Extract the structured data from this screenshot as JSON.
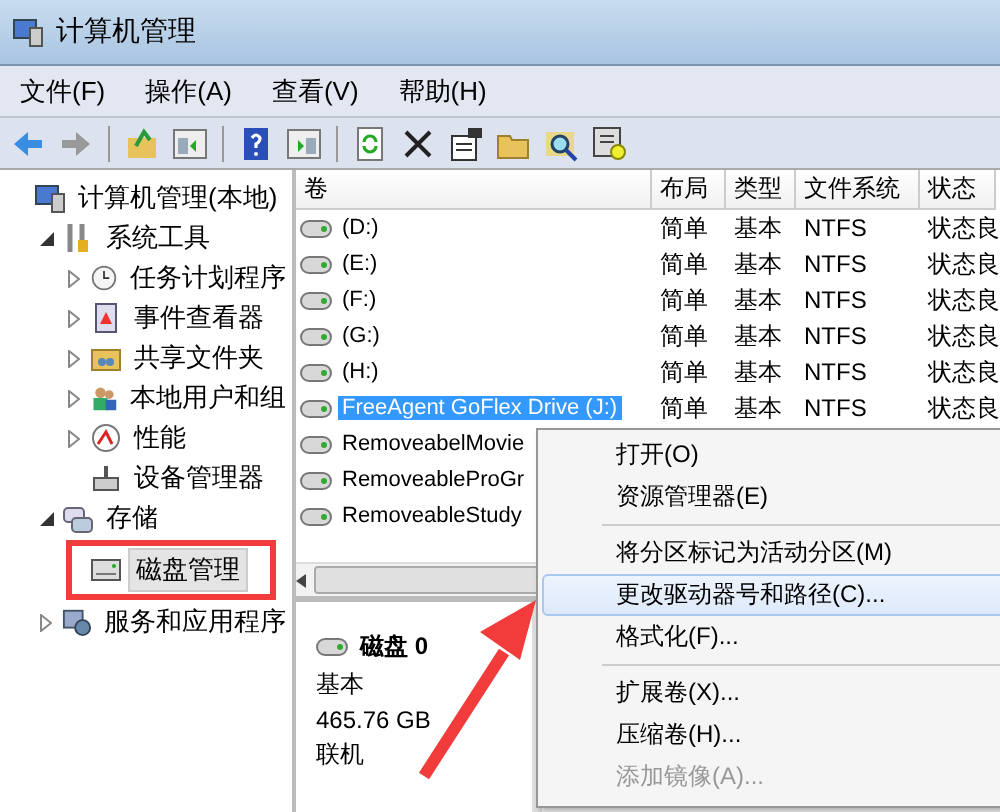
{
  "window": {
    "title": "计算机管理"
  },
  "menu_bar": [
    "文件(F)",
    "操作(A)",
    "查看(V)",
    "帮助(H)"
  ],
  "tree": {
    "label": "计算机管理(本地)",
    "selected": false,
    "children": [
      {
        "label": "系统工具",
        "expanded": true,
        "selected": false,
        "children": [
          {
            "label": "任务计划程序",
            "expanded": false,
            "selected": false
          },
          {
            "label": "事件查看器",
            "expanded": false,
            "selected": false
          },
          {
            "label": "共享文件夹",
            "expanded": false,
            "selected": false
          },
          {
            "label": "本地用户和组",
            "expanded": false,
            "selected": false
          },
          {
            "label": "性能",
            "expanded": false,
            "selected": false
          },
          {
            "label": "设备管理器",
            "selected": false
          }
        ]
      },
      {
        "label": "存储",
        "expanded": true,
        "selected": false,
        "children": [
          {
            "label": "磁盘管理",
            "selected": true
          }
        ]
      },
      {
        "label": "服务和应用程序",
        "expanded": false,
        "selected": false
      }
    ]
  },
  "table": {
    "columns": [
      "卷",
      "布局",
      "类型",
      "文件系统",
      "状态"
    ],
    "rows": [
      {
        "cells": [
          "(D:)",
          "简单",
          "基本",
          "NTFS",
          "状态良"
        ],
        "selected": false
      },
      {
        "cells": [
          "(E:)",
          "简单",
          "基本",
          "NTFS",
          "状态良"
        ],
        "selected": false
      },
      {
        "cells": [
          "(F:)",
          "简单",
          "基本",
          "NTFS",
          "状态良"
        ],
        "selected": false
      },
      {
        "cells": [
          "(G:)",
          "简单",
          "基本",
          "NTFS",
          "状态良"
        ],
        "selected": false
      },
      {
        "cells": [
          "(H:)",
          "简单",
          "基本",
          "NTFS",
          "状态良"
        ],
        "selected": false
      },
      {
        "cells": [
          "FreeAgent GoFlex Drive (J:)",
          "简单",
          "基本",
          "NTFS",
          "状态良"
        ],
        "selected": true
      },
      {
        "cells": [
          "RemoveabelMovie"
        ],
        "selected": false
      },
      {
        "cells": [
          "RemoveableProGr"
        ],
        "selected": false
      },
      {
        "cells": [
          "RemoveableStudy"
        ],
        "selected": false
      }
    ]
  },
  "disk": {
    "name": "磁盘 0",
    "type": "基本",
    "size": "465.76 GB",
    "status": "联机"
  },
  "context_menu": [
    {
      "kind": "item",
      "label": "打开(O)",
      "selected": false,
      "disabled": false
    },
    {
      "kind": "item",
      "label": "资源管理器(E)",
      "selected": false,
      "disabled": false
    },
    {
      "kind": "separator"
    },
    {
      "kind": "item",
      "label": "将分区标记为活动分区(M)",
      "selected": false,
      "disabled": false
    },
    {
      "kind": "item",
      "label": "更改驱动器号和路径(C)...",
      "selected": true,
      "disabled": false
    },
    {
      "kind": "item",
      "label": "格式化(F)...",
      "selected": false,
      "disabled": false
    },
    {
      "kind": "separator"
    },
    {
      "kind": "item",
      "label": "扩展卷(X)...",
      "selected": false,
      "disabled": false
    },
    {
      "kind": "item",
      "label": "压缩卷(H)...",
      "selected": false,
      "disabled": false
    },
    {
      "kind": "item",
      "label": "添加镜像(A)...",
      "selected": false,
      "disabled": true
    }
  ]
}
